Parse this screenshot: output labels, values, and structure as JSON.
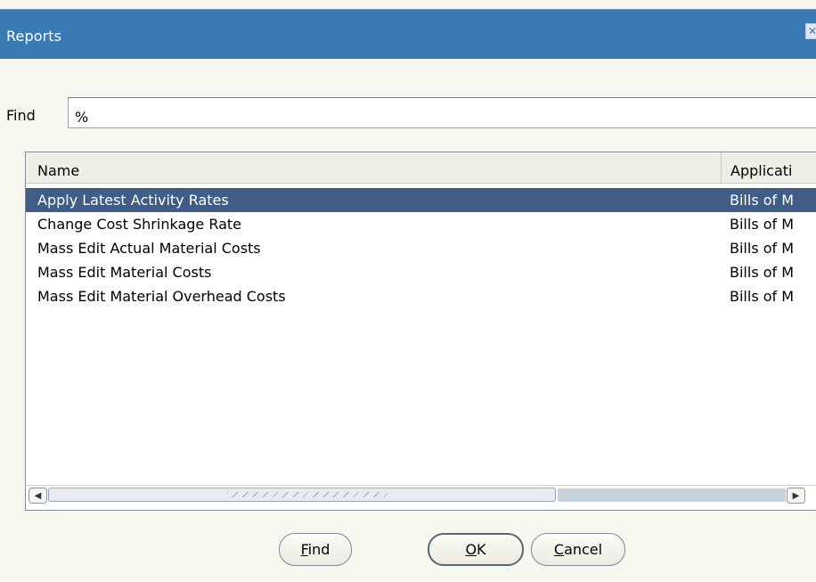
{
  "window": {
    "title": "Reports",
    "close_icon": "close-icon"
  },
  "find": {
    "label": "Find",
    "value": "%"
  },
  "list": {
    "columns": [
      "Name",
      "Applicati"
    ],
    "rows": [
      {
        "name": "Apply Latest Activity Rates",
        "application": "Bills of M",
        "selected": true
      },
      {
        "name": "Change Cost Shrinkage Rate",
        "application": "Bills of M",
        "selected": false
      },
      {
        "name": "Mass Edit Actual Material Costs",
        "application": "Bills of M",
        "selected": false
      },
      {
        "name": "Mass Edit Material Costs",
        "application": "Bills of M",
        "selected": false
      },
      {
        "name": "Mass Edit Material Overhead Costs",
        "application": "Bills of M",
        "selected": false
      }
    ]
  },
  "buttons": {
    "find_mnemonic": "F",
    "find_rest": "ind",
    "ok_mnemonic": "O",
    "ok_rest": "K",
    "cancel_mnemonic": "C",
    "cancel_rest": "ancel"
  },
  "colors": {
    "titlebar": "#3a7ab2",
    "selection": "#3f5d86",
    "background": "#f7f7ef"
  }
}
